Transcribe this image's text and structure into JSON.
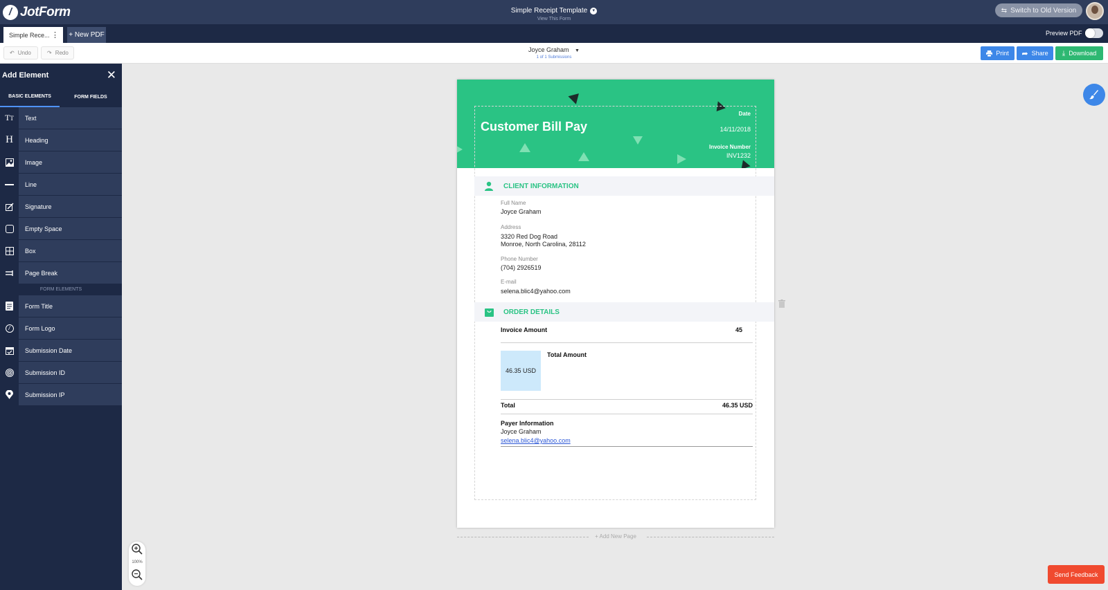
{
  "app": {
    "brand": "JotForm",
    "form_title": "Simple Receipt Template",
    "view_form": "View This Form",
    "switch_old": "Switch to Old Version"
  },
  "tabs": {
    "active_tab": "Simple Rece...",
    "new_pdf": "+ New PDF",
    "preview_pdf": "Preview PDF"
  },
  "toolbar": {
    "undo": "Undo",
    "redo": "Redo",
    "submitter": "Joyce Graham",
    "submission_count": "1 of 1 Submissions",
    "print": "Print",
    "share": "Share",
    "download": "Download"
  },
  "sidebar": {
    "title": "Add Element",
    "tab_basic": "BASIC ELEMENTS",
    "tab_fields": "FORM FIELDS",
    "basic_items": [
      {
        "label": "Text",
        "icon": "text-icon"
      },
      {
        "label": "Heading",
        "icon": "heading-icon"
      },
      {
        "label": "Image",
        "icon": "image-icon"
      },
      {
        "label": "Line",
        "icon": "line-icon"
      },
      {
        "label": "Signature",
        "icon": "signature-icon"
      },
      {
        "label": "Empty Space",
        "icon": "empty-space-icon"
      },
      {
        "label": "Box",
        "icon": "box-icon"
      },
      {
        "label": "Page Break",
        "icon": "page-break-icon"
      }
    ],
    "section_form": "FORM ELEMENTS",
    "form_items": [
      {
        "label": "Form Title",
        "icon": "form-title-icon"
      },
      {
        "label": "Form Logo",
        "icon": "form-logo-icon"
      },
      {
        "label": "Submission Date",
        "icon": "calendar-icon"
      },
      {
        "label": "Submission ID",
        "icon": "fingerprint-icon"
      },
      {
        "label": "Submission IP",
        "icon": "location-pin-icon"
      }
    ]
  },
  "document": {
    "header": {
      "title": "Customer Bill Pay",
      "date_label": "Date",
      "date_value": "14/11/2018",
      "invoice_label": "Invoice Number",
      "invoice_value": "INV1232"
    },
    "client": {
      "section_title": "CLIENT INFORMATION",
      "full_name_label": "Full Name",
      "full_name": "Joyce Graham",
      "address_label": "Address",
      "address_line1": "3320 Red Dog Road",
      "address_line2": "Monroe, North Carolina, 28112",
      "phone_label": "Phone Number",
      "phone": "(704) 2926519",
      "email_label": "E-mail",
      "email": "selena.blic4@yahoo.com"
    },
    "order": {
      "section_title": "ORDER DETAILS",
      "invoice_amount_label": "Invoice Amount",
      "invoice_amount": "45",
      "amount_box": "46.35 USD",
      "total_amount_label": "Total Amount",
      "total_label": "Total",
      "total_value": "46.35 USD",
      "payer_label": "Payer Information",
      "payer_name": "Joyce Graham",
      "payer_email": "selena.blic4@yahoo.com"
    },
    "add_page": "+ Add New Page"
  },
  "zoom": {
    "value": "100%"
  },
  "feedback": "Send Feedback",
  "colors": {
    "accent_green": "#2ac384",
    "nav_dark": "#1d2945",
    "nav": "#2f3d5c",
    "action_blue": "#3d87e8",
    "download_green": "#2eb872",
    "feedback_red": "#f04a2f"
  }
}
